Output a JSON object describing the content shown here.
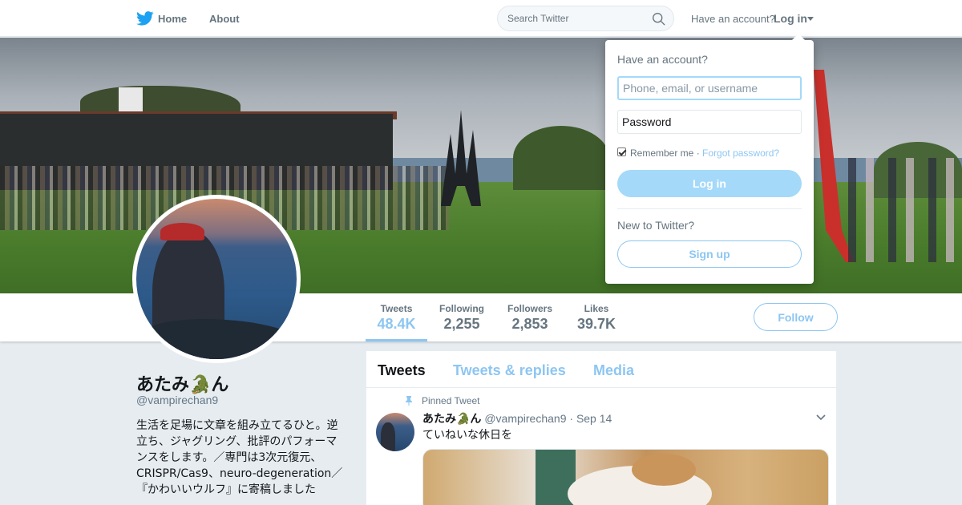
{
  "nav": {
    "home_label": "Home",
    "about_label": "About",
    "search_placeholder": "Search Twitter",
    "have_account_text": "Have an account?",
    "login_label": "Log in"
  },
  "profile_nav": {
    "stats": [
      {
        "label": "Tweets",
        "value": "48.4K"
      },
      {
        "label": "Following",
        "value": "2,255"
      },
      {
        "label": "Followers",
        "value": "2,853"
      },
      {
        "label": "Likes",
        "value": "39.7K"
      }
    ],
    "follow_label": "Follow"
  },
  "profile": {
    "name": "あたみ🐊ん",
    "handle": "@vampirechan9",
    "bio": "生活を足場に文章を組み立てるひと。逆立ち、ジャグリング、批評のパフォーマンスをします。／専門は3次元復元、CRISPR/Cas9、neuro-degeneration／『かわいいウルフ』に寄稿しました"
  },
  "timeline": {
    "tabs": [
      "Tweets",
      "Tweets & replies",
      "Media"
    ],
    "pinned_label": "Pinned Tweet",
    "tweet": {
      "name": "あたみ🐊ん",
      "handle": "@vampirechan9",
      "separator": "·",
      "date": "Sep 14",
      "text": "ていねいな休日を"
    }
  },
  "login_dropdown": {
    "title": "Have an account?",
    "username_placeholder": "Phone, email, or username",
    "password_placeholder": "Password",
    "remember_label": "Remember me",
    "separator": "·",
    "forgot_label": "Forgot password?",
    "login_button": "Log in",
    "new_text": "New to Twitter?",
    "signup_button": "Sign up"
  },
  "colors": {
    "brand_blue": "#1da1f2",
    "light_blue": "#8dc6f2",
    "text_gray": "#66757f"
  }
}
